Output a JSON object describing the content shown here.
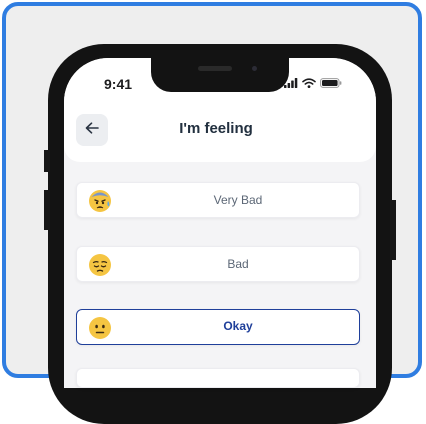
{
  "status_bar": {
    "time": "9:41",
    "icons": [
      "signal-icon",
      "wifi-icon",
      "battery-icon"
    ]
  },
  "header": {
    "back_icon": "arrow-left-icon",
    "title": "I'm feeling"
  },
  "options": [
    {
      "label": "Very Bad",
      "emoji": "anxious-sweat-face-icon",
      "selected": false
    },
    {
      "label": "Bad",
      "emoji": "pensive-face-icon",
      "selected": false
    },
    {
      "label": "Okay",
      "emoji": "neutral-face-icon",
      "selected": true
    }
  ],
  "colors": {
    "frame_border": "#2f7de1",
    "selected_border": "#1f3f9a",
    "selected_text": "#1f3f9a",
    "label_text": "#5c6776",
    "emoji_fill": "#f5c542"
  }
}
